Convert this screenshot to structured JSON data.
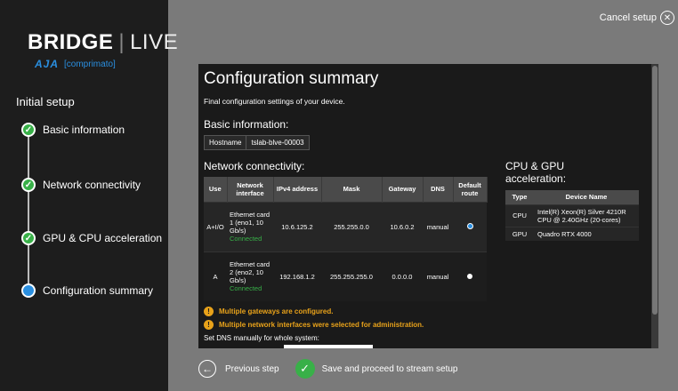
{
  "sidebar": {
    "logo_bold": "BRIDGE",
    "logo_sep": "|",
    "logo_light": "LIVE",
    "logo_aja": "AJA",
    "logo_comprimato": "[comprimato]",
    "initial_setup": "Initial setup",
    "steps": [
      {
        "label": "Basic information",
        "state": "done"
      },
      {
        "label": "Network connectivity",
        "state": "done"
      },
      {
        "label": "GPU & CPU acceleration",
        "state": "done"
      },
      {
        "label": "Configuration summary",
        "state": "current"
      }
    ]
  },
  "header": {
    "cancel_label": "Cancel setup"
  },
  "panel": {
    "title": "Configuration summary",
    "subtitle": "Final configuration settings of your device.",
    "basic_heading": "Basic information:",
    "hostname_label": "Hostname",
    "hostname_value": "tslab-blve-00003",
    "network_heading": "Network connectivity:",
    "network_columns": [
      "Use",
      "Network interface",
      "IPv4 address",
      "Mask",
      "Gateway",
      "DNS",
      "Default route"
    ],
    "network_rows": [
      {
        "use": "A+I/O",
        "iface": "Ethernet card 1 (eno1, 10 Gb/s)",
        "status": "Connected",
        "ipv4": "10.6.125.2",
        "mask": "255.255.0.0",
        "gateway": "10.6.0.2",
        "dns": "manual",
        "default": true
      },
      {
        "use": "A",
        "iface": "Ethernet card 2 (eno2, 10 Gb/s)",
        "status": "Connected",
        "ipv4": "192.168.1.2",
        "mask": "255.255.255.0",
        "gateway": "0.0.0.0",
        "dns": "manual",
        "default": false
      }
    ],
    "cpu_heading": "CPU & GPU acceleration:",
    "cpu_columns": [
      "Type",
      "Device Name"
    ],
    "cpu_rows": [
      {
        "type": "CPU",
        "name": "Intel(R) Xeon(R) Silver 4210R CPU @ 2.40GHz (20-cores)"
      },
      {
        "type": "GPU",
        "name": "Quadro RTX 4000"
      }
    ],
    "warnings": [
      "Multiple gateways are configured.",
      "Multiple network interfaces were selected for administration."
    ],
    "dns_label": "Set DNS manually for whole system:"
  },
  "footer": {
    "previous_label": "Previous step",
    "next_label": "Save and proceed to stream setup"
  },
  "colors": {
    "accent_green": "#38b048",
    "accent_blue": "#2a8fe0",
    "warning": "#e8a21a"
  }
}
